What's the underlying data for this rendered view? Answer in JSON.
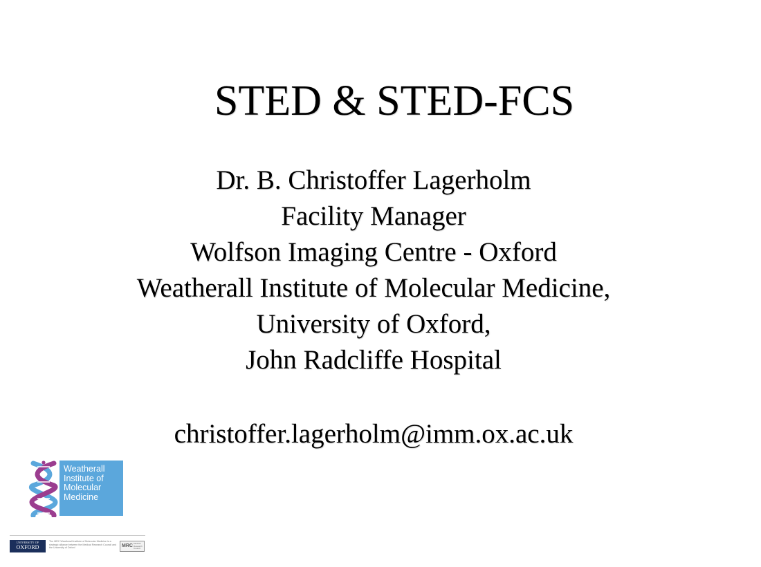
{
  "slide": {
    "title": "STED & STED-FCS",
    "author_lines": [
      "Dr. B. Christoffer Lagerholm",
      "Facility Manager",
      "Wolfson Imaging Centre - Oxford",
      "Weatherall Institute of Molecular Medicine,",
      "University of Oxford,",
      "John Radcliffe Hospital"
    ],
    "email": "christoffer.lagerholm@imm.ox.ac.uk"
  },
  "logo": {
    "lines": [
      "Weatherall",
      "Institute of",
      "Molecular",
      "Medicine"
    ],
    "icon": "dna-helix-icon",
    "box_color": "#5ba7dc",
    "helix_colors": [
      "#5ba7dc",
      "#9b3d8f"
    ]
  },
  "footer": {
    "oxford_top": "UNIVERSITY OF",
    "oxford_name": "OXFORD",
    "alliance_text": "The MRC Weatherall Institute of Molecular Medicine is a strategic alliance between the Medical Research Council and the University of Oxford",
    "mrc_letters": "MRC",
    "mrc_sub": "Medical Research Council",
    "oxford_color": "#1b2f5b"
  }
}
